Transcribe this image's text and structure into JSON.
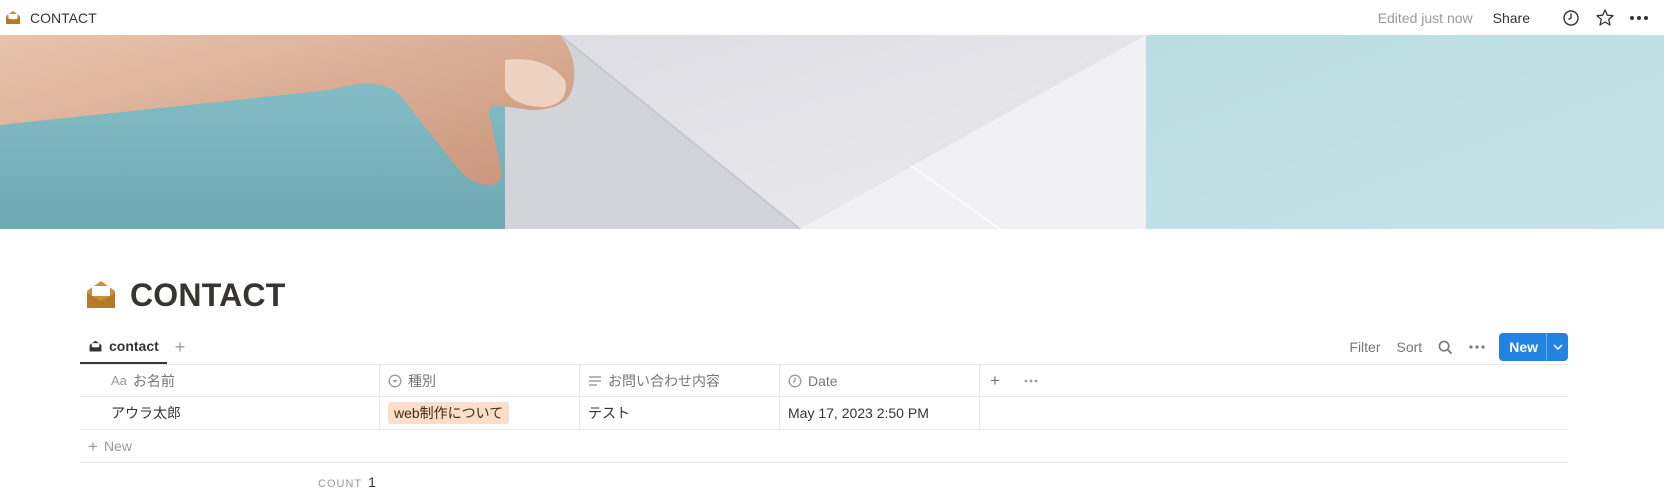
{
  "topbar": {
    "breadcrumb_title": "CONTACT",
    "breadcrumb_icon": "envelope-open-icon",
    "edited": "Edited just now",
    "share_label": "Share",
    "icons": [
      "clock-icon",
      "star-icon",
      "more-icon"
    ]
  },
  "cover": {
    "description_icon": "envelope-photo-cover"
  },
  "page": {
    "title": "CONTACT",
    "icon": "envelope-open-icon",
    "accent": "#c9923a"
  },
  "views": {
    "active_tab": "contact",
    "add_view_label": "+"
  },
  "toolbar": {
    "filter_label": "Filter",
    "sort_label": "Sort",
    "new_label": "New",
    "new_color": "#2383e2"
  },
  "table": {
    "columns": [
      {
        "icon_text": "Aa",
        "label": "お名前"
      },
      {
        "icon": "select-icon",
        "label": "種別"
      },
      {
        "icon": "text-lines-icon",
        "label": "お問い合わせ内容"
      },
      {
        "icon": "clock-icon",
        "label": "Date"
      }
    ],
    "add_column_label": "+",
    "rows": [
      {
        "name": "アウラ太郎",
        "type": "web制作について",
        "content": "テスト",
        "date": "May 17, 2023 2:50 PM"
      }
    ],
    "new_row_label": "New",
    "tag_color": "#fadec9"
  },
  "footer": {
    "count_label": "COUNT",
    "count_value": "1"
  }
}
